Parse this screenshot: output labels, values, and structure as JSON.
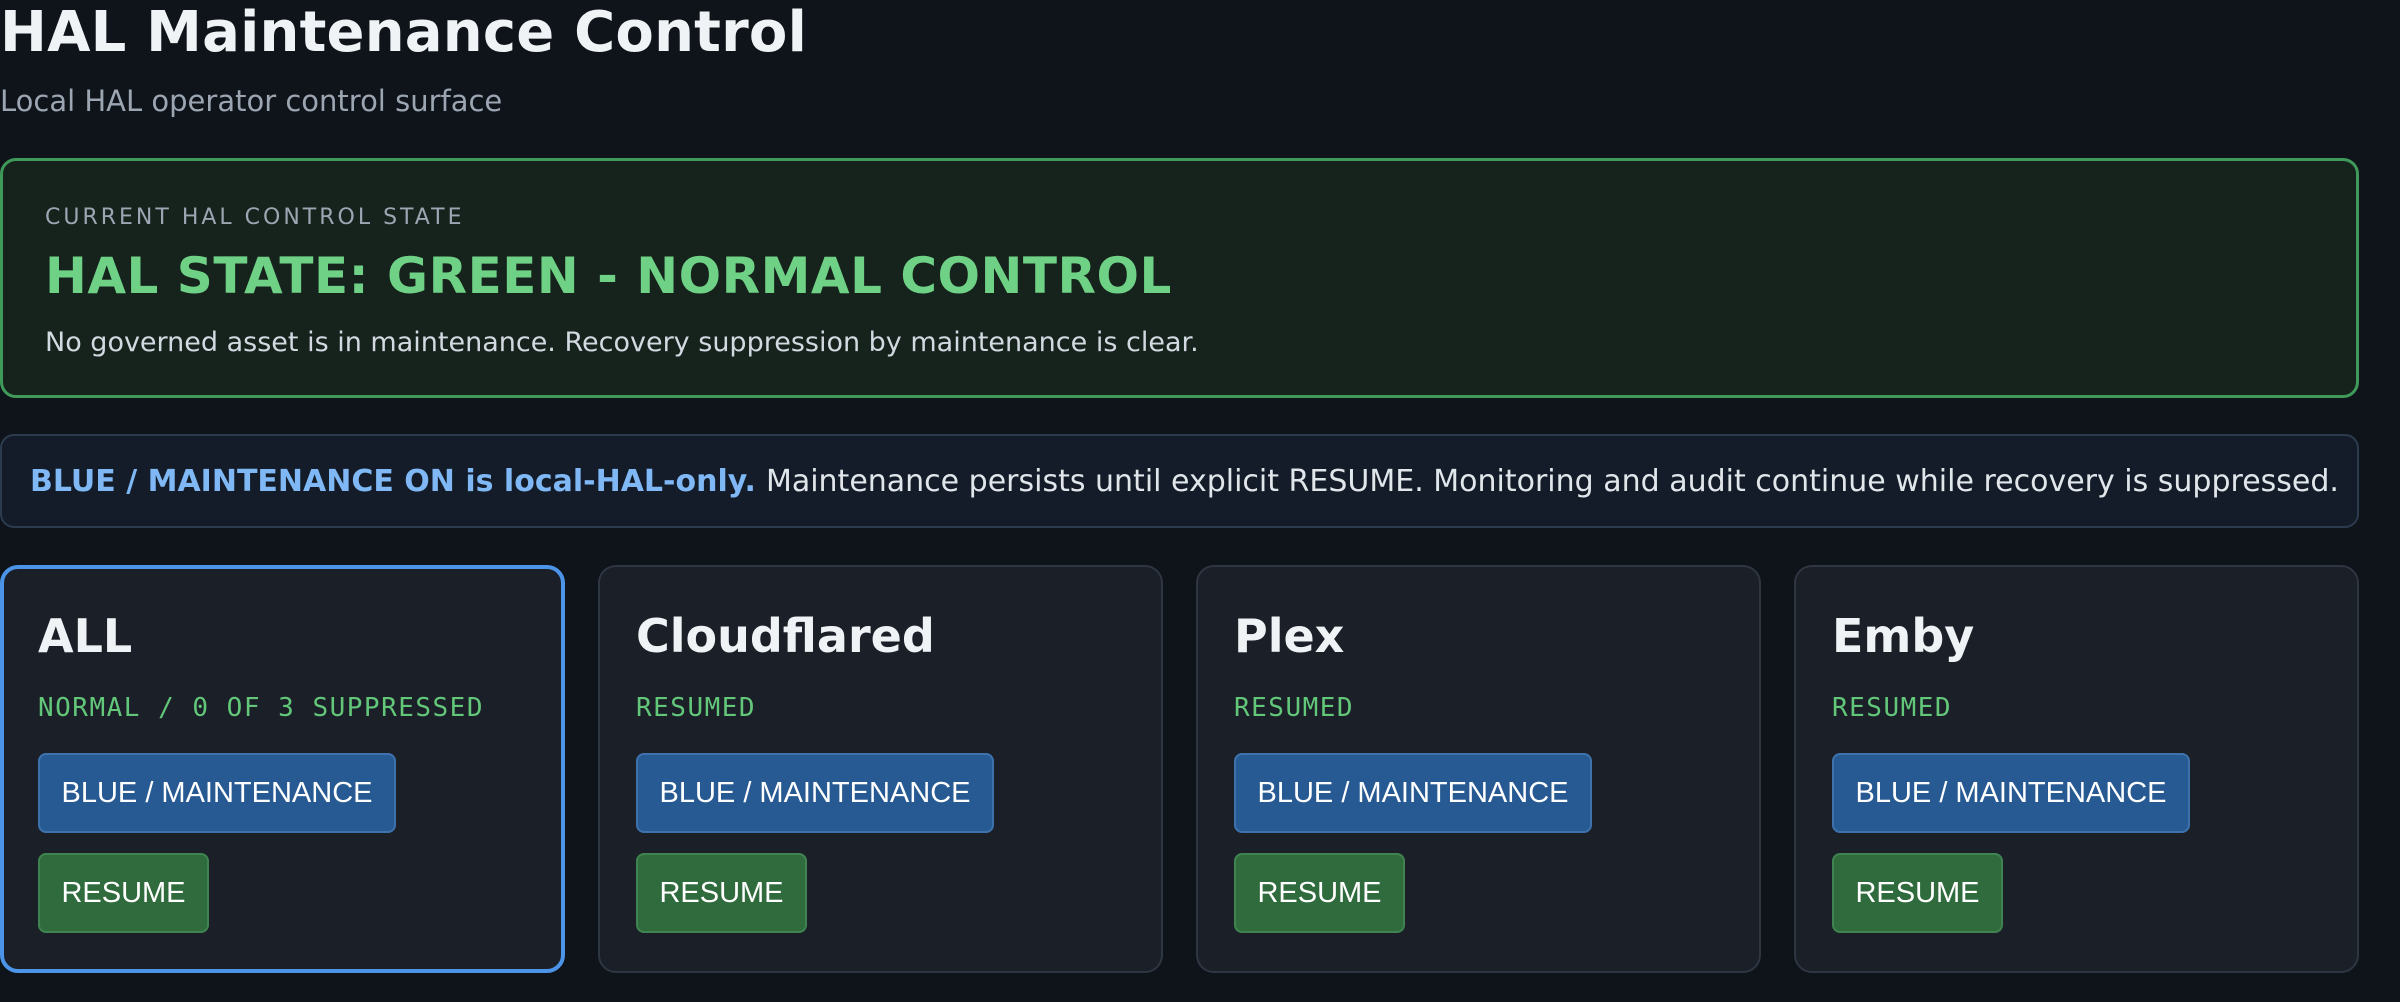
{
  "header": {
    "title": "HAL Maintenance Control",
    "subtitle": "Local HAL operator control surface"
  },
  "state_panel": {
    "eyebrow": "CURRENT HAL CONTROL STATE",
    "headline": "HAL STATE: GREEN - NORMAL CONTROL",
    "detail": "No governed asset is in maintenance. Recovery suppression by maintenance is clear.",
    "accent_color": "#6fd185"
  },
  "info_banner": {
    "strong": "BLUE / MAINTENANCE ON is local-HAL-only.",
    "text": "Maintenance persists until explicit RESUME. Monitoring and audit continue while recovery is suppressed.",
    "accent_color": "#7fb8f5"
  },
  "cards": [
    {
      "title": "ALL",
      "status": "NORMAL / 0 OF 3 SUPPRESSED",
      "maintenance_label": "BLUE / MAINTENANCE",
      "resume_label": "RESUME",
      "selected": true
    },
    {
      "title": "Cloudflared",
      "status": "RESUMED",
      "maintenance_label": "BLUE / MAINTENANCE",
      "resume_label": "RESUME",
      "selected": false
    },
    {
      "title": "Plex",
      "status": "RESUMED",
      "maintenance_label": "BLUE / MAINTENANCE",
      "resume_label": "RESUME",
      "selected": false
    },
    {
      "title": "Emby",
      "status": "RESUMED",
      "maintenance_label": "BLUE / MAINTENANCE",
      "resume_label": "RESUME",
      "selected": false
    }
  ],
  "colors": {
    "background": "#0f131a",
    "maintenance_button": "#275a92",
    "resume_button": "#2f6b3c",
    "selected_border": "#4b94e8",
    "status_green": "#63c77a"
  }
}
